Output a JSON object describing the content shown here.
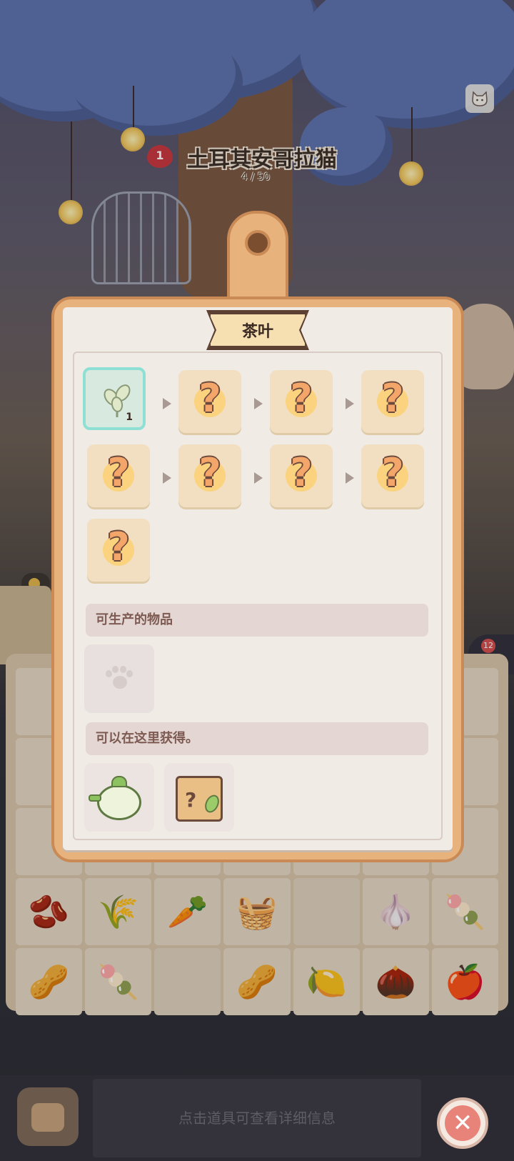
{
  "scene": {
    "level": "1",
    "cat_name": "土耳其安哥拉猫",
    "progress": "4 / 50",
    "badge_count": "12"
  },
  "panel": {
    "title": "茶叶",
    "first_item_count": "1",
    "unknown_symbol": "?",
    "producible_header": "可生产的物品",
    "obtain_header": "可以在这里获得。"
  },
  "bottom": {
    "hint": "点击道具可查看详细信息",
    "close_symbol": "✕"
  },
  "board_items": [
    "🫘",
    "🌾",
    "🥕",
    "🧺",
    "",
    "🧄",
    "🍡",
    "🥜",
    "🍡",
    "",
    "🥜",
    "🍋",
    "🌰",
    "🍎"
  ]
}
